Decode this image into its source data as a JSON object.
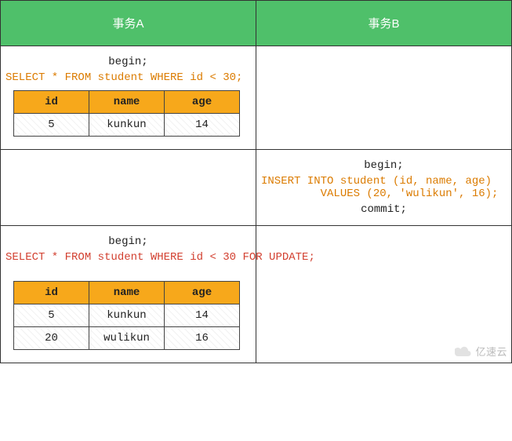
{
  "header": {
    "colA": "事务A",
    "colB": "事务B"
  },
  "rows": [
    {
      "A": {
        "lines": [
          {
            "kind": "stmt",
            "text": "begin;"
          },
          {
            "kind": "sql",
            "color": "orange",
            "text": "SELECT * FROM student WHERE id < 30;"
          }
        ],
        "table": {
          "columns": [
            "id",
            "name",
            "age"
          ],
          "rows": [
            [
              "5",
              "kunkun",
              "14"
            ]
          ]
        }
      },
      "B": {
        "lines": [],
        "table": null
      }
    },
    {
      "A": {
        "lines": [],
        "table": null
      },
      "B": {
        "lines": [
          {
            "kind": "stmt",
            "text": "begin;"
          },
          {
            "kind": "sql",
            "color": "orange",
            "text": "INSERT INTO student (id, name, age)\n         VALUES (20, 'wulikun', 16);"
          },
          {
            "kind": "stmt",
            "text": "commit;"
          }
        ],
        "table": null
      }
    },
    {
      "A": {
        "lines": [
          {
            "kind": "stmt",
            "text": "begin;"
          },
          {
            "kind": "sql",
            "color": "red",
            "text": "SELECT * FROM student WHERE id < 30 FOR UPDATE;"
          }
        ],
        "table": {
          "columns": [
            "id",
            "name",
            "age"
          ],
          "rows": [
            [
              "5",
              "kunkun",
              "14"
            ],
            [
              "20",
              "wulikun",
              "16"
            ]
          ]
        }
      },
      "B": {
        "lines": [],
        "table": null
      }
    }
  ],
  "watermark": "亿速云"
}
